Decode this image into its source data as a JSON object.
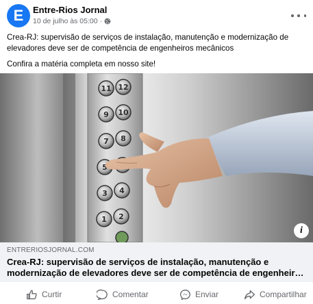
{
  "header": {
    "avatar_letter": "E",
    "page_name": "Entre-Rios Jornal",
    "timestamp": "10 de julho às 05:00",
    "separator": "·",
    "privacy_icon": "globe-icon",
    "more_icon": "more-options-icon"
  },
  "post": {
    "text_line1": "Crea-RJ: supervisão de serviços de instalação, manutenção e modernização de elevadores deve ser de competência de engenheiros mecânicos",
    "text_line2": "Confira a matéria completa em nosso site!"
  },
  "media": {
    "image_description": "elevator-panel-photo",
    "info_button": "i"
  },
  "link_preview": {
    "domain": "ENTRERIOSJORNAL.COM",
    "title": "Crea-RJ: supervisão de serviços de instalação, manutenção e modernização de elevadores deve ser de competência de engenheiros mecânicos"
  },
  "actions": {
    "like": "Curtir",
    "comment": "Comentar",
    "send": "Enviar",
    "share": "Compartilhar"
  },
  "colors": {
    "brand": "#1877f2",
    "secondary_text": "#65676b",
    "link_background": "#f0f2f5"
  }
}
